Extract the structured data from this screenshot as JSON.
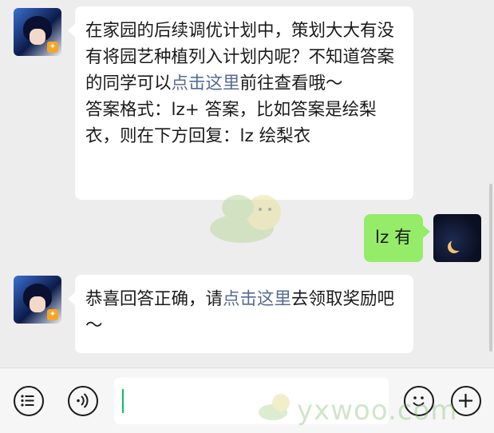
{
  "messages": [
    {
      "side": "left",
      "segments": [
        {
          "text": "在家园的后续调优计划中，策划大大有没有将园艺种植列入计划内呢？不知道答案的同学可以",
          "link": false
        },
        {
          "text": "点击这里",
          "link": true
        },
        {
          "text": "前往查看哦～",
          "link": false
        }
      ],
      "line2": "答案格式：lz+ 答案，比如答案是绘梨衣，则在下方回复：lz 绘梨衣"
    },
    {
      "side": "right",
      "text": "lz 有"
    },
    {
      "side": "left",
      "segments": [
        {
          "text": "恭喜回答正确，请",
          "link": false
        },
        {
          "text": "点击这里",
          "link": true
        },
        {
          "text": "去领取奖励吧～",
          "link": false
        }
      ]
    }
  ],
  "input": {
    "value": ""
  },
  "watermark": "yxwoo.com",
  "icons": [
    "menu-list-icon",
    "voice-icon",
    "emoji-icon",
    "plus-icon"
  ],
  "colors": {
    "background": "#ededed",
    "bubble_left": "#ffffff",
    "bubble_right": "#95ec69",
    "link": "#576b95",
    "caret": "#07c160"
  }
}
